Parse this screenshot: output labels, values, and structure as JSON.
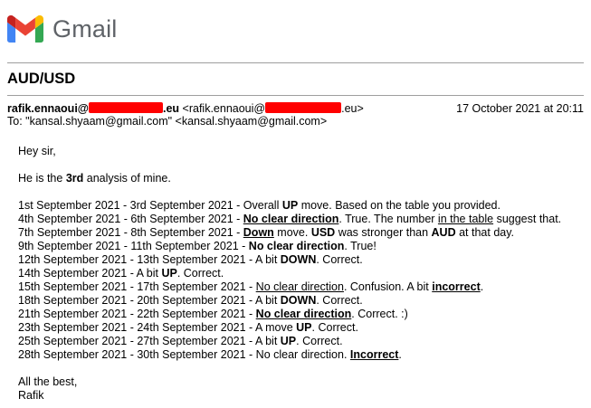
{
  "app": {
    "name": "Gmail",
    "logo": "gmail-m-logo"
  },
  "email": {
    "subject": "AUD/USD",
    "from": {
      "name": "rafik.ennaoui@",
      "domain_suffix": ".eu",
      "address_prefix": "<rafik.ennaoui@",
      "address_suffix": ".eu>"
    },
    "date": "17 October 2021 at 20:11",
    "to": "To: \"kansal.shyaam@gmail.com\" <kansal.shyaam@gmail.com>",
    "greeting": "Hey sir,",
    "intro": {
      "pre": "He is the ",
      "bold": "3rd",
      "post": " analysis of mine."
    },
    "lines": [
      {
        "date": "1st September 2021 - 3rd September 2021 - ",
        "a": "Overall ",
        "b": "UP",
        "c": " move. Based on the table you provided."
      },
      {
        "date": "4th September 2021 - 6th September 2021 - ",
        "bu": "No clear direction",
        "c": ". True. The number ",
        "u": "in the table",
        "d": " suggest that."
      },
      {
        "date": "7th September 2021 - 8th September 2021 - ",
        "bu": "Down",
        "c": " move. ",
        "b": "USD",
        "d": " was stronger than ",
        "b2": "AUD",
        "e": " at that day."
      },
      {
        "date": "9th September 2021 - 11th September 2021 - ",
        "b": "No clear direction",
        "c": ". True!"
      },
      {
        "date": "12th September 2021 - 13th September 2021 - ",
        "a": "A bit ",
        "b": "DOWN",
        "c": ". Correct."
      },
      {
        "date": "14th September 2021 - ",
        "a": "A bit ",
        "b": "UP",
        "c": ". Correct."
      },
      {
        "date": "15th September 2021 - 17th September 2021 - ",
        "u": "No clear direction",
        "c": ". Confusion. A bit ",
        "bu": "incorrect",
        "d": "."
      },
      {
        "date": "18th September 2021 - 20th September 2021 - ",
        "a": "A bit ",
        "b": "DOWN",
        "c": ". Correct."
      },
      {
        "date": "21th September 2021 - 22th September 2021 - ",
        "bu": "No clear direction",
        "c": ". Correct. :)"
      },
      {
        "date": "23th September 2021 - 24th September 2021 - ",
        "a": "A move ",
        "b": "UP",
        "c": ". Correct."
      },
      {
        "date": "25th September 2021 - 27th September 2021 - ",
        "a": "A bit ",
        "b": "UP",
        "c": ". Correct."
      },
      {
        "date": "28th September 2021 - 30th September 2021 - ",
        "a": "No clear direction. ",
        "bu": "Incorrect",
        "c": "."
      }
    ],
    "closing": "All the best,",
    "signature": "Rafik"
  },
  "colors": {
    "redaction": "#ff0000",
    "wordmark": "#5f6368",
    "rule": "#9e9e9e"
  }
}
